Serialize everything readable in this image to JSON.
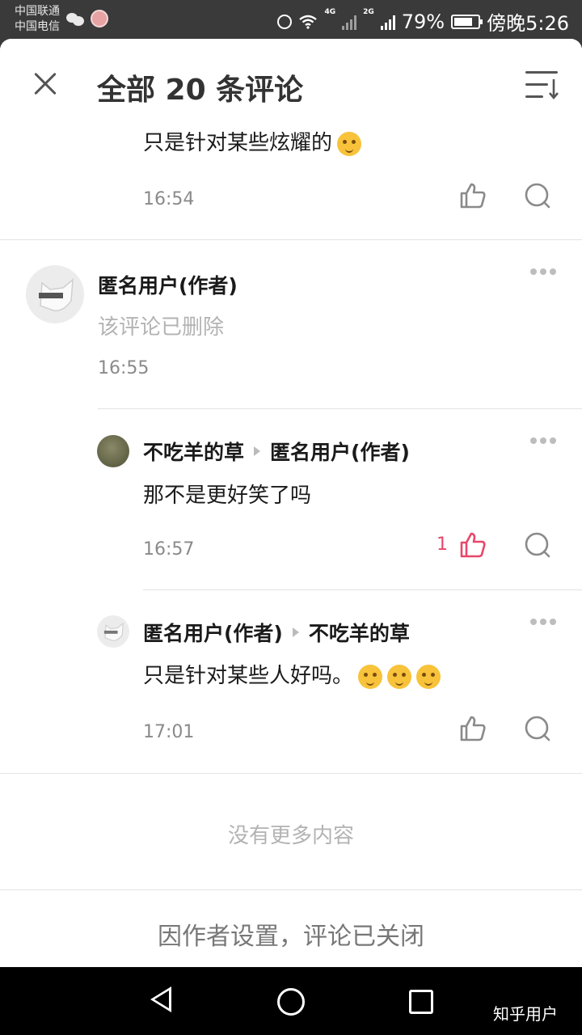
{
  "status_bar": {
    "carrier_1": "中国联通",
    "carrier_2": "中国电信",
    "net_1": "4G",
    "net_2": "2G",
    "battery_percent": "79%",
    "battery_level": 0.79,
    "time": "傍晚5:26"
  },
  "header": {
    "title": "全部 20 条评论"
  },
  "comments": {
    "partial": {
      "text": "只是针对某些炫耀的",
      "time": "16:54"
    },
    "root": {
      "author": "匿名用户(作者)",
      "text": "该评论已删除",
      "time": "16:55"
    },
    "reply_1": {
      "author": "不吃羊的草",
      "reply_to": "匿名用户(作者)",
      "text": "那不是更好笑了吗",
      "time": "16:57",
      "likes": "1"
    },
    "reply_2": {
      "author": "匿名用户(作者)",
      "reply_to": "不吃羊的草",
      "text": "只是针对某些人好吗。",
      "time": "17:01"
    }
  },
  "footer": {
    "no_more": "没有更多内容",
    "closed_note": "因作者设置，评论已关闭"
  },
  "watermark": "知乎用户",
  "colors": {
    "liked": "#e8476a",
    "muted": "#8a8a8a"
  }
}
